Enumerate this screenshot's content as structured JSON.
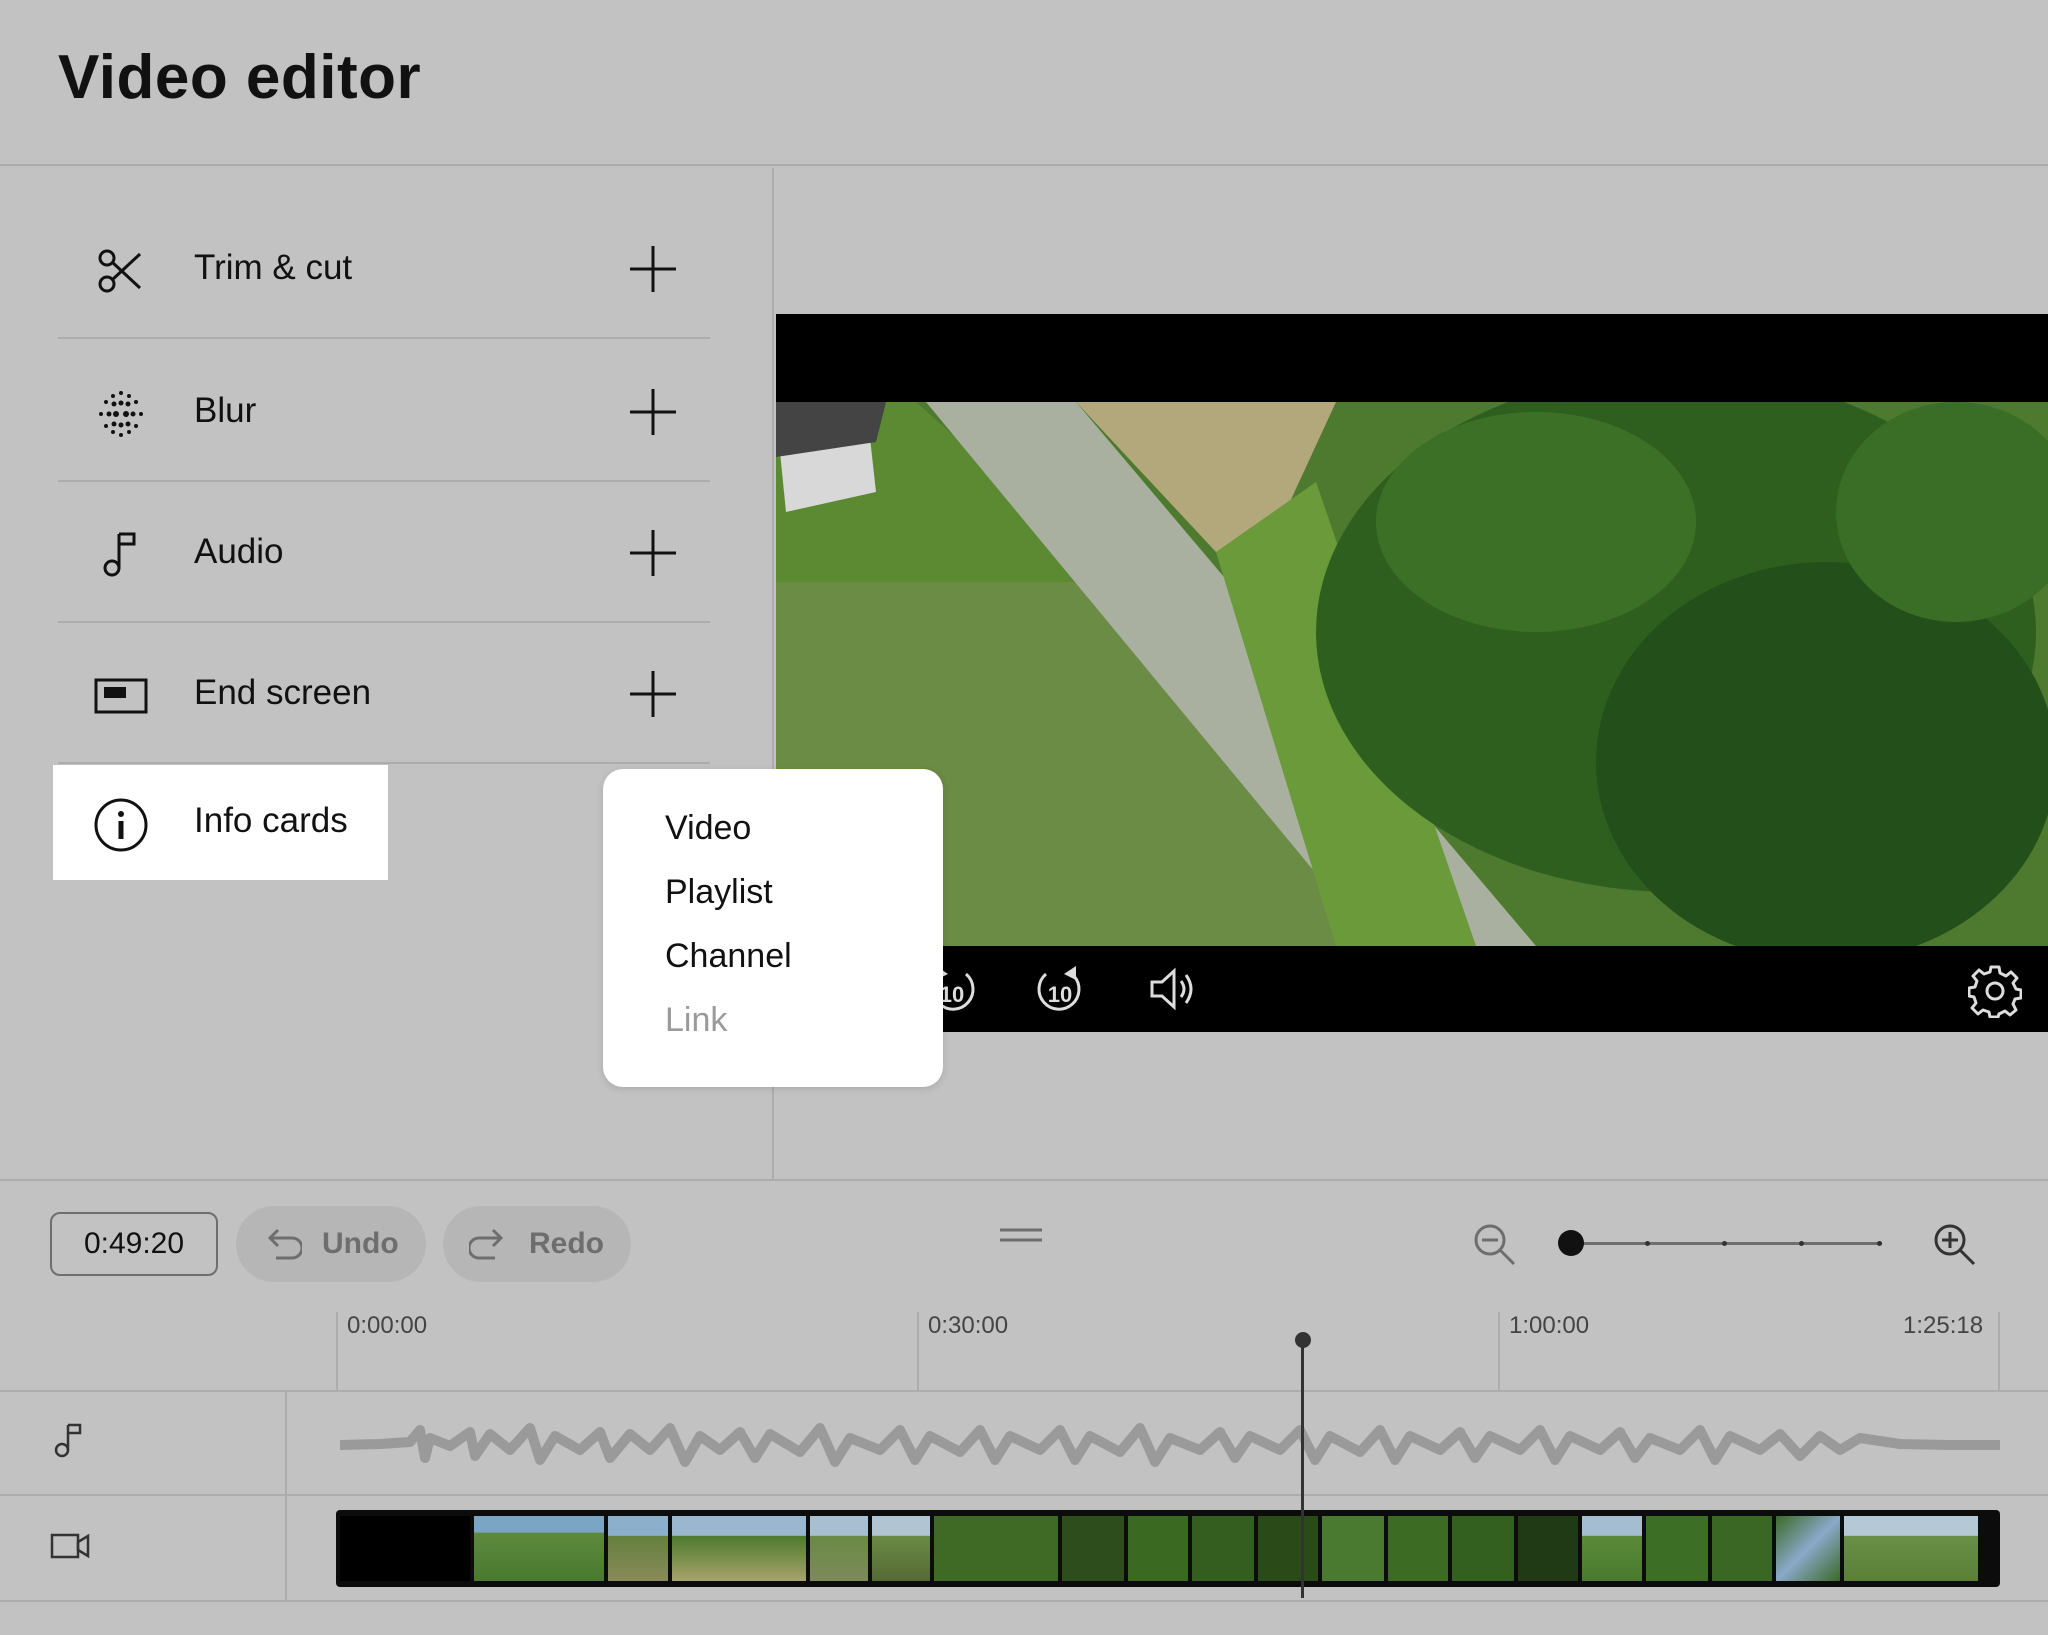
{
  "header": {
    "title": "Video editor"
  },
  "tools": [
    {
      "label": "Trim & cut",
      "icon": "scissors-icon"
    },
    {
      "label": "Blur",
      "icon": "blur-icon"
    },
    {
      "label": "Audio",
      "icon": "music-note-icon"
    },
    {
      "label": "End screen",
      "icon": "end-screen-icon"
    },
    {
      "label": "Info cards",
      "icon": "info-icon"
    }
  ],
  "info_cards_menu": {
    "items": [
      {
        "label": "Video",
        "enabled": true
      },
      {
        "label": "Playlist",
        "enabled": true
      },
      {
        "label": "Channel",
        "enabled": true
      },
      {
        "label": "Link",
        "enabled": false
      }
    ]
  },
  "player": {
    "controls": [
      "rewind-10-icon",
      "forward-10-icon",
      "volume-icon",
      "settings-gear-icon"
    ],
    "skip_seconds": "10"
  },
  "toolbar": {
    "timecode": "0:49:20",
    "undo_label": "Undo",
    "redo_label": "Redo",
    "zoom_level": 0
  },
  "timeline": {
    "markers": [
      "0:00:00",
      "0:30:00",
      "1:00:00",
      "1:25:18"
    ],
    "tracks": [
      "audio-track-icon",
      "video-track-icon"
    ]
  },
  "colors": {
    "background": "#c2c2c2",
    "panel_highlight": "#ffffff",
    "player_background": "#000000",
    "disabled_text": "#9a9a9a"
  }
}
